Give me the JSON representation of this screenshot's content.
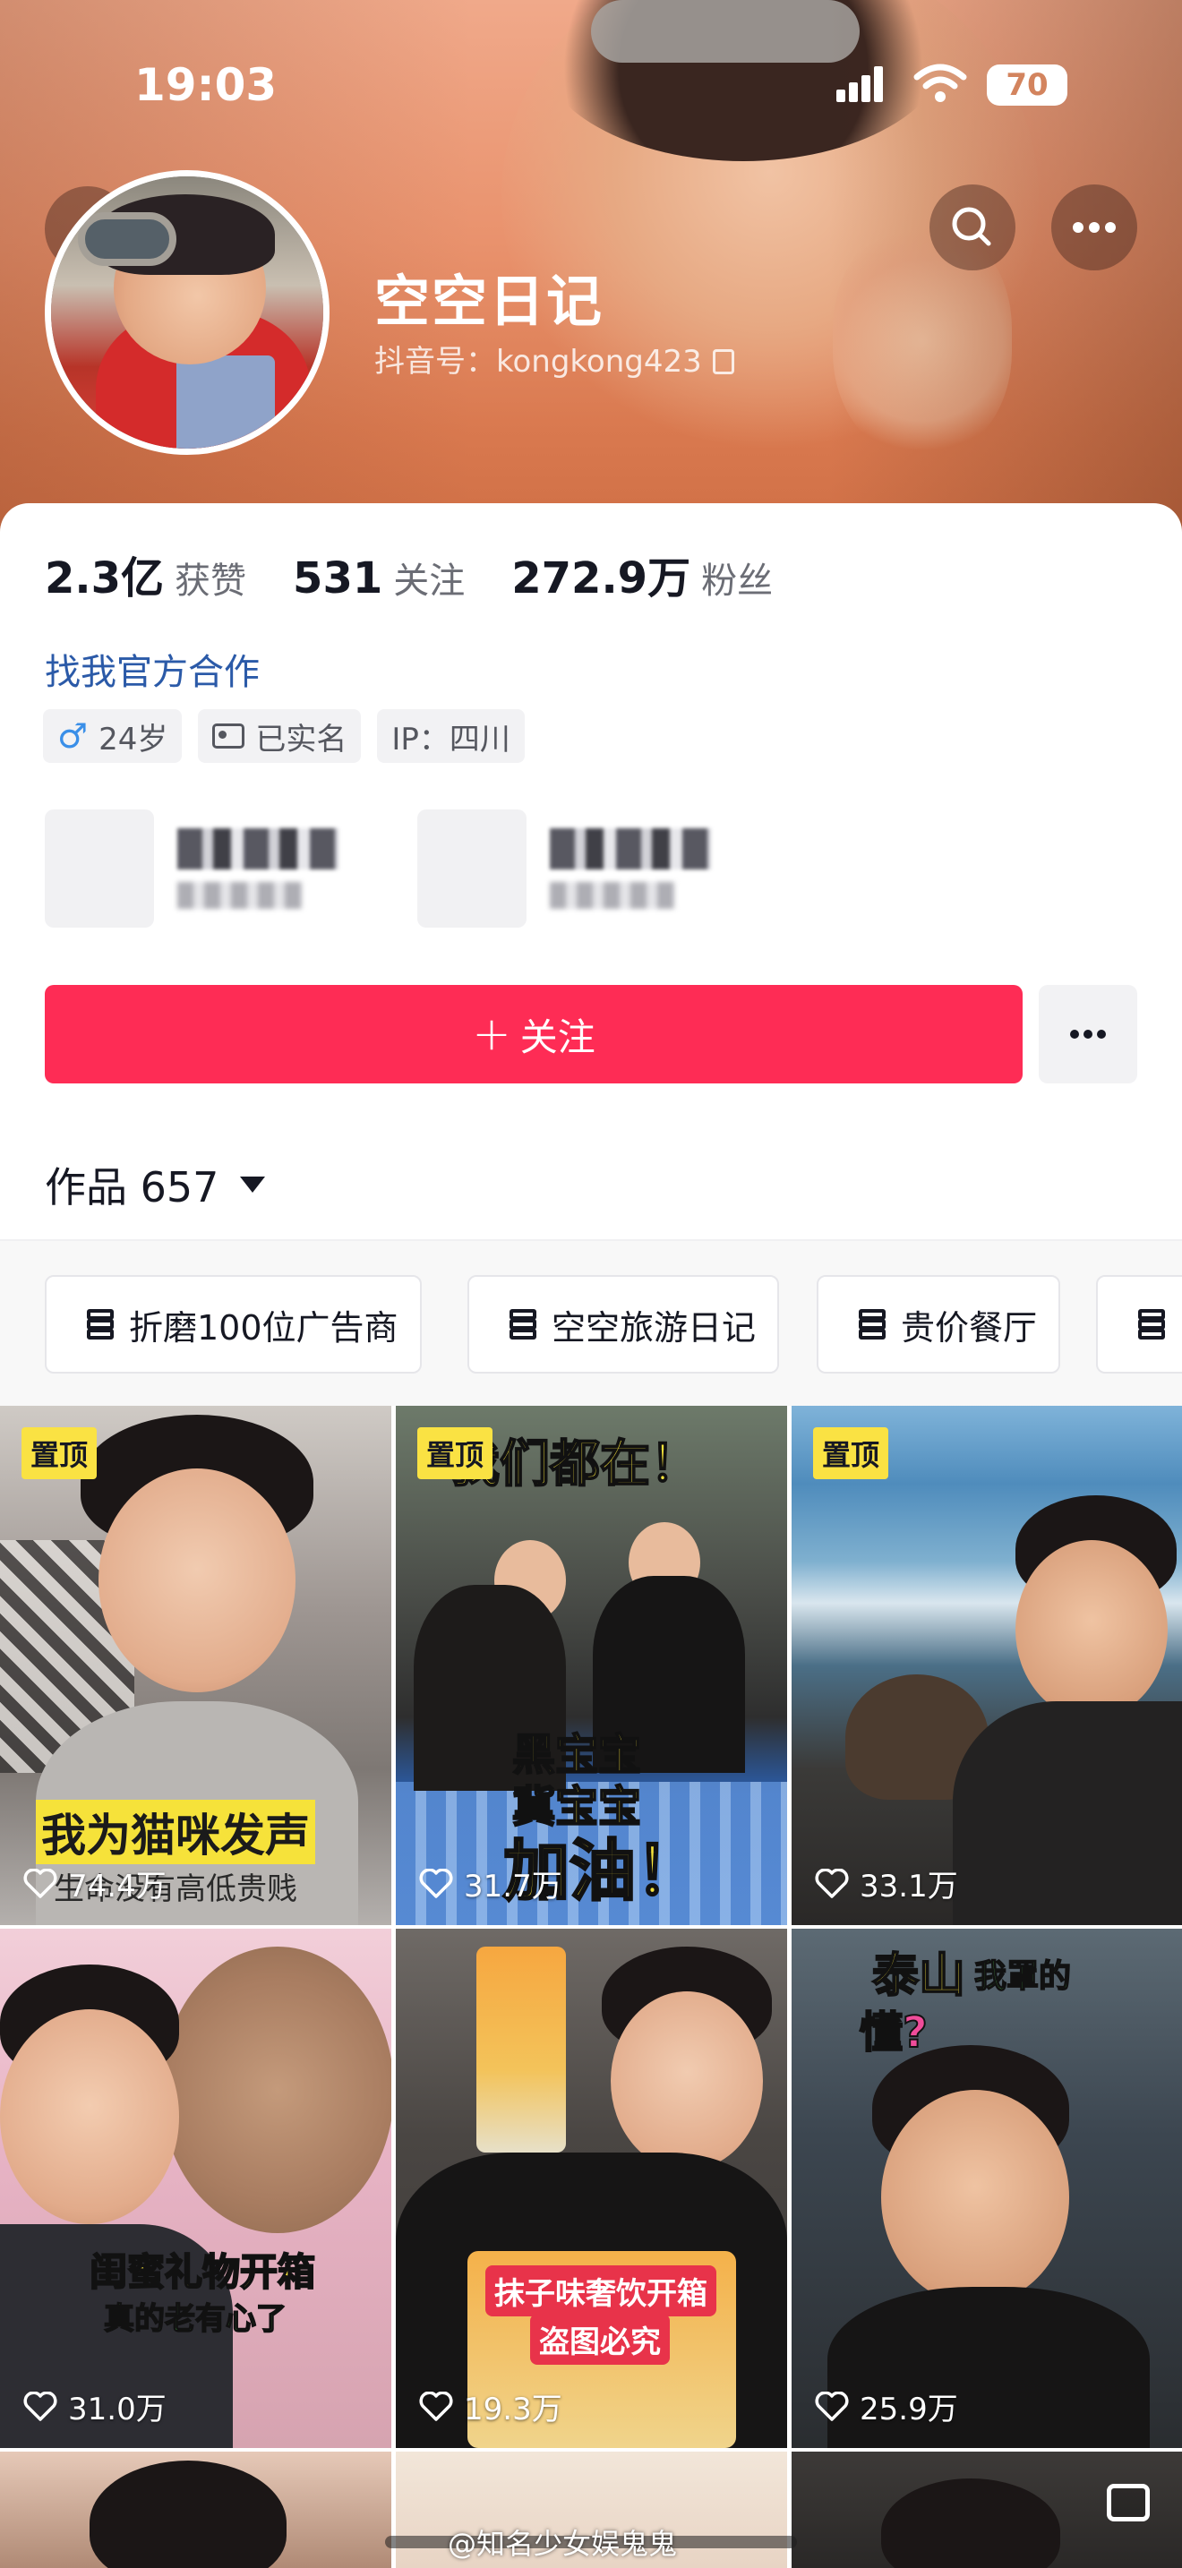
{
  "status_bar": {
    "time": "19:03",
    "battery": "70"
  },
  "profile": {
    "name": "空空日记",
    "douyin_id": "抖音号：kongkong423"
  },
  "stats": [
    {
      "value": "2.3亿",
      "label": "获赞"
    },
    {
      "value": "531",
      "label": "关注"
    },
    {
      "value": "272.9万",
      "label": "粉丝"
    }
  ],
  "cooperation_link": "找我官方合作",
  "tags": {
    "age": "24岁",
    "verified": "已实名",
    "ip": "IP：四川",
    "male_symbol": "♂"
  },
  "follow_button": {
    "plus": "+",
    "label": "关注"
  },
  "works": {
    "label": "作品 657"
  },
  "collections": [
    "折磨100位广告商",
    "空空旅游日记",
    "贵价餐厅"
  ],
  "videos": [
    {
      "pinned": "置顶",
      "likes": "74.4万",
      "caption": "我为猫咪发声",
      "subcaption": "生命没有高低贵贱"
    },
    {
      "pinned": "置顶",
      "likes": "31.7万",
      "caption": "我们都在！",
      "subcaption": "黑宝宝",
      "caption3": "冀宝宝",
      "caption4": "加油！"
    },
    {
      "pinned": "置顶",
      "likes": "33.1万"
    },
    {
      "likes": "31.0万",
      "caption": "闺蜜礼物开箱",
      "subcaption": "真的老有心了"
    },
    {
      "likes": "19.3万",
      "caption": "抹子味奢饮开箱",
      "subcaption": "盗图必究"
    },
    {
      "likes": "25.9万",
      "caption": "泰山",
      "subcaption": "我罩的",
      "caption3": "懂?"
    }
  ],
  "watermark": "@知名少女娱鬼鬼",
  "colors": {
    "follow": "#fe2c55",
    "link": "#2b5aa8",
    "pin_badge": "#fae243"
  }
}
